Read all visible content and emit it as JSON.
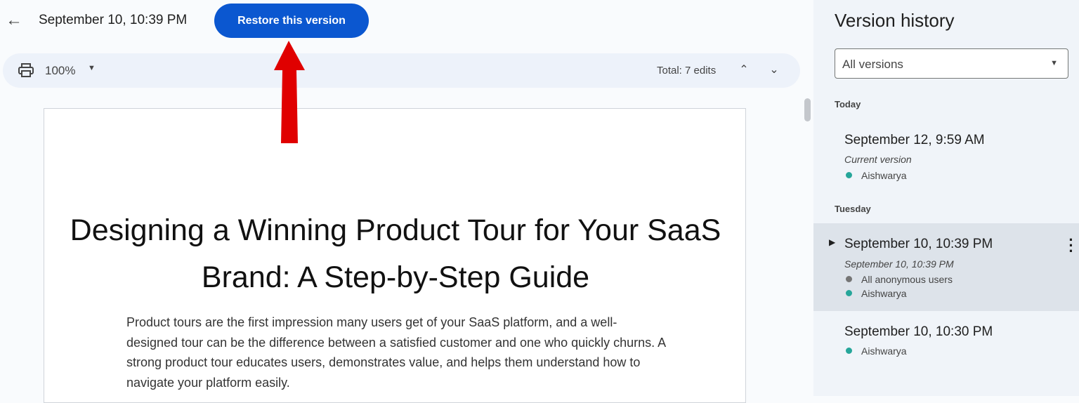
{
  "header": {
    "title": "September 10, 10:39 PM",
    "restore_label": "Restore this version"
  },
  "toolbar": {
    "zoom": "100%",
    "total": "Total: 7 edits"
  },
  "document": {
    "title": "Designing a Winning Product Tour for Your SaaS Brand: A Step-by-Step Guide",
    "body": "Product tours are the first impression many users get of your SaaS platform, and a well-designed tour can be the difference between a satisfied customer and one who quickly churns. A strong product tour educates users, demonstrates value, and helps them understand how to navigate your platform easily."
  },
  "panel": {
    "title": "Version history",
    "filter": "All versions",
    "groups": [
      {
        "label": "Today",
        "versions": [
          {
            "time": "September 12, 9:59 AM",
            "sub": "Current version",
            "users": [
              {
                "name": "Aishwarya",
                "color": "#26a69a"
              }
            ]
          }
        ]
      },
      {
        "label": "Tuesday",
        "versions": [
          {
            "time": "September 10, 10:39 PM",
            "sub": "September 10, 10:39 PM",
            "users": [
              {
                "name": "All anonymous users",
                "color": "#757575"
              },
              {
                "name": "Aishwarya",
                "color": "#26a69a"
              }
            ]
          },
          {
            "time": "September 10, 10:30 PM",
            "users": [
              {
                "name": "Aishwarya",
                "color": "#26a69a"
              }
            ]
          }
        ]
      }
    ]
  },
  "colors": {
    "accent": "#0b57d0",
    "annotation_arrow": "#e00000"
  }
}
